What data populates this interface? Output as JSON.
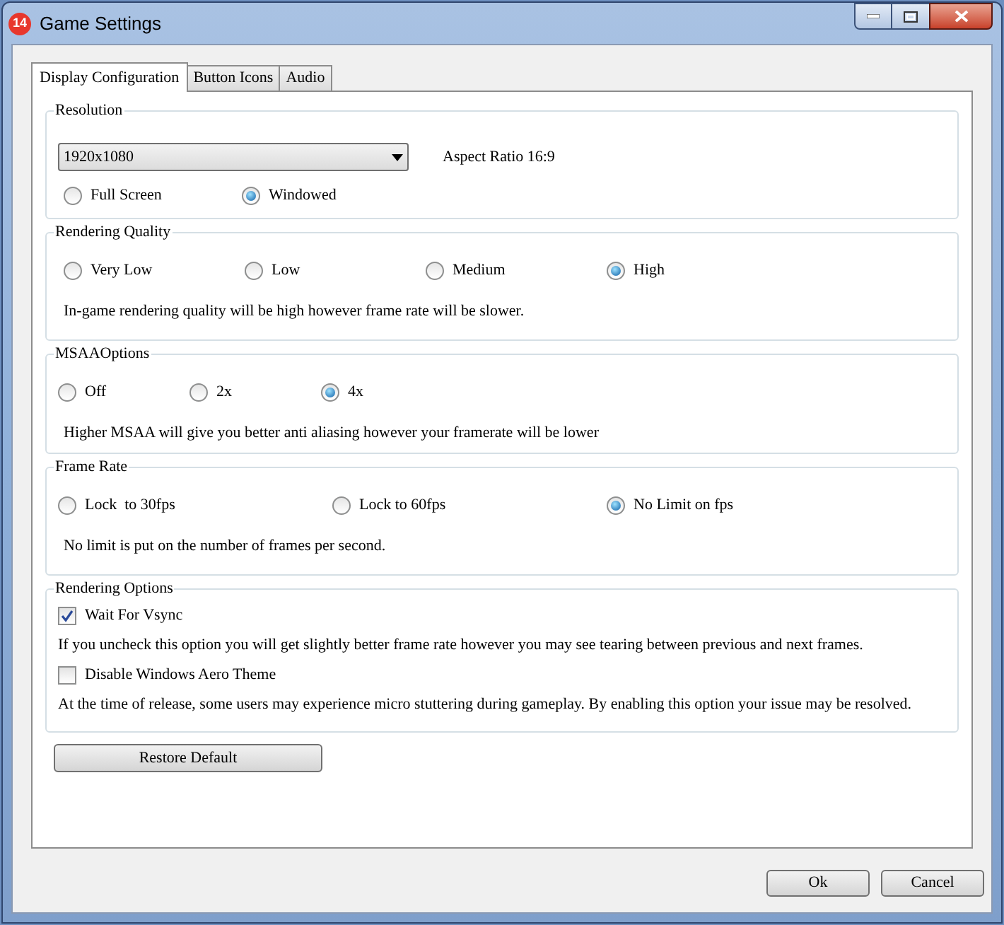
{
  "window": {
    "title": "Game Settings",
    "badge": "14"
  },
  "tabs": [
    {
      "label": "Display Configuration",
      "selected": true
    },
    {
      "label": "Button Icons",
      "selected": false
    },
    {
      "label": "Audio",
      "selected": false
    }
  ],
  "groups": [
    {
      "kind": "resolution",
      "title": "Resolution",
      "dropdown": {
        "value": "1920x1080"
      },
      "aspect": "Aspect Ratio 16:9",
      "options": [
        {
          "label": "Full Screen",
          "selected": false
        },
        {
          "label": "Windowed",
          "selected": true
        }
      ]
    },
    {
      "kind": "radio",
      "title": "Rendering Quality",
      "options": [
        {
          "label": "Very Low",
          "selected": false
        },
        {
          "label": "Low",
          "selected": false
        },
        {
          "label": "Medium",
          "selected": false
        },
        {
          "label": "High",
          "selected": true
        }
      ],
      "description": "In-game rendering quality will be high however frame rate will be slower."
    },
    {
      "kind": "radio",
      "title": "MSAAOptions",
      "options": [
        {
          "label": "Off",
          "selected": false
        },
        {
          "label": "2x",
          "selected": false
        },
        {
          "label": "4x",
          "selected": true
        }
      ],
      "description": "Higher MSAA will give you better anti aliasing however your framerate will be lower"
    },
    {
      "kind": "radio",
      "title": "Frame Rate",
      "options": [
        {
          "label": "Lock  to 30fps",
          "selected": false
        },
        {
          "label": "Lock to 60fps",
          "selected": false
        },
        {
          "label": "No Limit on fps",
          "selected": true
        }
      ],
      "description": "No limit is put on the number of frames per second."
    },
    {
      "kind": "checks",
      "title": "Rendering Options",
      "items": [
        {
          "label": "Wait For Vsync",
          "checked": true,
          "description": "If you uncheck this option you will get slightly better frame rate however you may see tearing between previous and next frames."
        },
        {
          "label": "Disable Windows Aero Theme",
          "checked": false,
          "description": "At the time of release, some users may experience micro stuttering during gameplay. By enabling this option your issue may be resolved."
        }
      ]
    }
  ],
  "restore_button": "Restore Default",
  "buttons": [
    "Ok",
    "Cancel"
  ]
}
